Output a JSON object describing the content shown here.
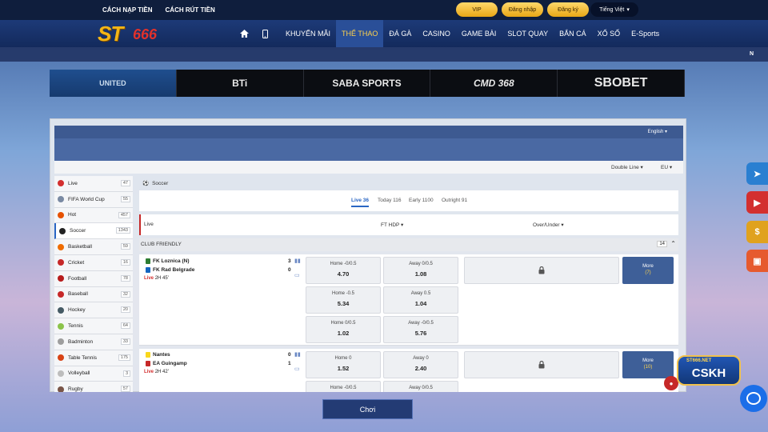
{
  "topbar": {
    "links": [
      "CÁCH NẠP TIỀN",
      "CÁCH RÚT TIỀN"
    ],
    "vip": "VIP",
    "login": "Đăng nhập",
    "register": "Đăng ký",
    "language": "Tiếng Việt"
  },
  "logo": {
    "main": "ST",
    "num": "666"
  },
  "nav": [
    "KHUYẾN MÃI",
    "THỂ THAO",
    "ĐÁ GÀ",
    "CASINO",
    "GAME BÀI",
    "SLOT QUAY",
    "BẮN CÁ",
    "XỔ SỐ",
    "E-Sports"
  ],
  "strip_letter": "N",
  "providers": [
    "UNITED",
    "BTi",
    "SABA SPORTS",
    "CMD 368",
    "SBOBET"
  ],
  "sportsbook": {
    "language": "English ▾",
    "line_type": "Double Line ▾",
    "odds_type": "EU ▾"
  },
  "sidebar": [
    {
      "label": "Live",
      "count": "47",
      "color": "#d32f2f"
    },
    {
      "label": "FIFA World Cup",
      "count": "55",
      "color": "#7a8aa3"
    },
    {
      "label": "Hot",
      "count": "457",
      "color": "#e65100"
    },
    {
      "label": "Soccer",
      "count": "1343",
      "color": "#222222"
    },
    {
      "label": "Basketball",
      "count": "59",
      "color": "#ef6c00"
    },
    {
      "label": "Cricket",
      "count": "16",
      "color": "#c62828"
    },
    {
      "label": "Football",
      "count": "78",
      "color": "#b71c1c"
    },
    {
      "label": "Baseball",
      "count": "32",
      "color": "#c62828"
    },
    {
      "label": "Hockey",
      "count": "20",
      "color": "#455a64"
    },
    {
      "label": "Tennis",
      "count": "64",
      "color": "#8bc34a"
    },
    {
      "label": "Badminton",
      "count": "33",
      "color": "#9e9e9e"
    },
    {
      "label": "Table Tennis",
      "count": "175",
      "color": "#d84315"
    },
    {
      "label": "Volleyball",
      "count": "3",
      "color": "#bdbdbd"
    },
    {
      "label": "Rugby",
      "count": "57",
      "color": "#795548"
    }
  ],
  "content": {
    "crumb": "Soccer",
    "tabs": [
      "Live 36",
      "Today 116",
      "Early 1100",
      "Outright 91"
    ],
    "header": {
      "col1": "Live",
      "col2": "FT HDP ▾",
      "col3": "Over/Under ▾"
    },
    "league": {
      "name": "CLUB FRIENDLY",
      "count": "14"
    },
    "matches": [
      {
        "home": "FK Loznica (N)",
        "away": "FK Rad Belgrade",
        "home_score": "3",
        "away_score": "0",
        "live_label": "Live",
        "time": "2H 45'",
        "odds": [
          {
            "home_lbl": "Home -0/0.5",
            "home_val": "4.70",
            "away_lbl": "Away 0/0.5",
            "away_val": "1.08"
          },
          {
            "home_lbl": "Home -0.5",
            "home_val": "5.34",
            "away_lbl": "Away 0.5",
            "away_val": "1.04"
          },
          {
            "home_lbl": "Home 0/0.5",
            "home_val": "1.02",
            "away_lbl": "Away -0/0.5",
            "away_val": "5.76"
          }
        ],
        "more": "More",
        "more_count": "(7)"
      },
      {
        "home": "Nantes",
        "away": "EA Guingamp",
        "home_score": "0",
        "away_score": "1",
        "live_label": "Live",
        "time": "2H 42'",
        "odds": [
          {
            "home_lbl": "Home 0",
            "home_val": "1.52",
            "away_lbl": "Away 0",
            "away_val": "2.40"
          },
          {
            "home_lbl": "Home -0/0.5",
            "home_val": "",
            "away_lbl": "Away 0/0.5",
            "away_val": ""
          }
        ],
        "more": "More",
        "more_count": "(10)"
      }
    ]
  },
  "play_button": "Chơi",
  "support": {
    "brand": "ST666.NET",
    "label": "CSKH"
  }
}
